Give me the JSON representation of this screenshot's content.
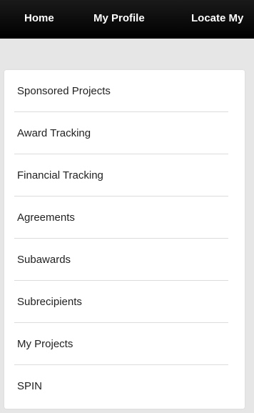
{
  "topnav": {
    "items": [
      {
        "label": "Home"
      },
      {
        "label": "My Profile"
      },
      {
        "label": "Locate My"
      }
    ]
  },
  "menu": {
    "items": [
      {
        "label": "Sponsored Projects"
      },
      {
        "label": "Award Tracking"
      },
      {
        "label": "Financial Tracking"
      },
      {
        "label": "Agreements"
      },
      {
        "label": "Subawards"
      },
      {
        "label": "Subrecipients"
      },
      {
        "label": "My Projects"
      },
      {
        "label": "SPIN"
      }
    ]
  },
  "colors": {
    "nav_background": "#000000",
    "nav_text": "#ffffff",
    "page_background": "#e6e6e6",
    "panel_background": "#ffffff",
    "menu_text": "#222222",
    "divider": "#dcdcdc"
  }
}
